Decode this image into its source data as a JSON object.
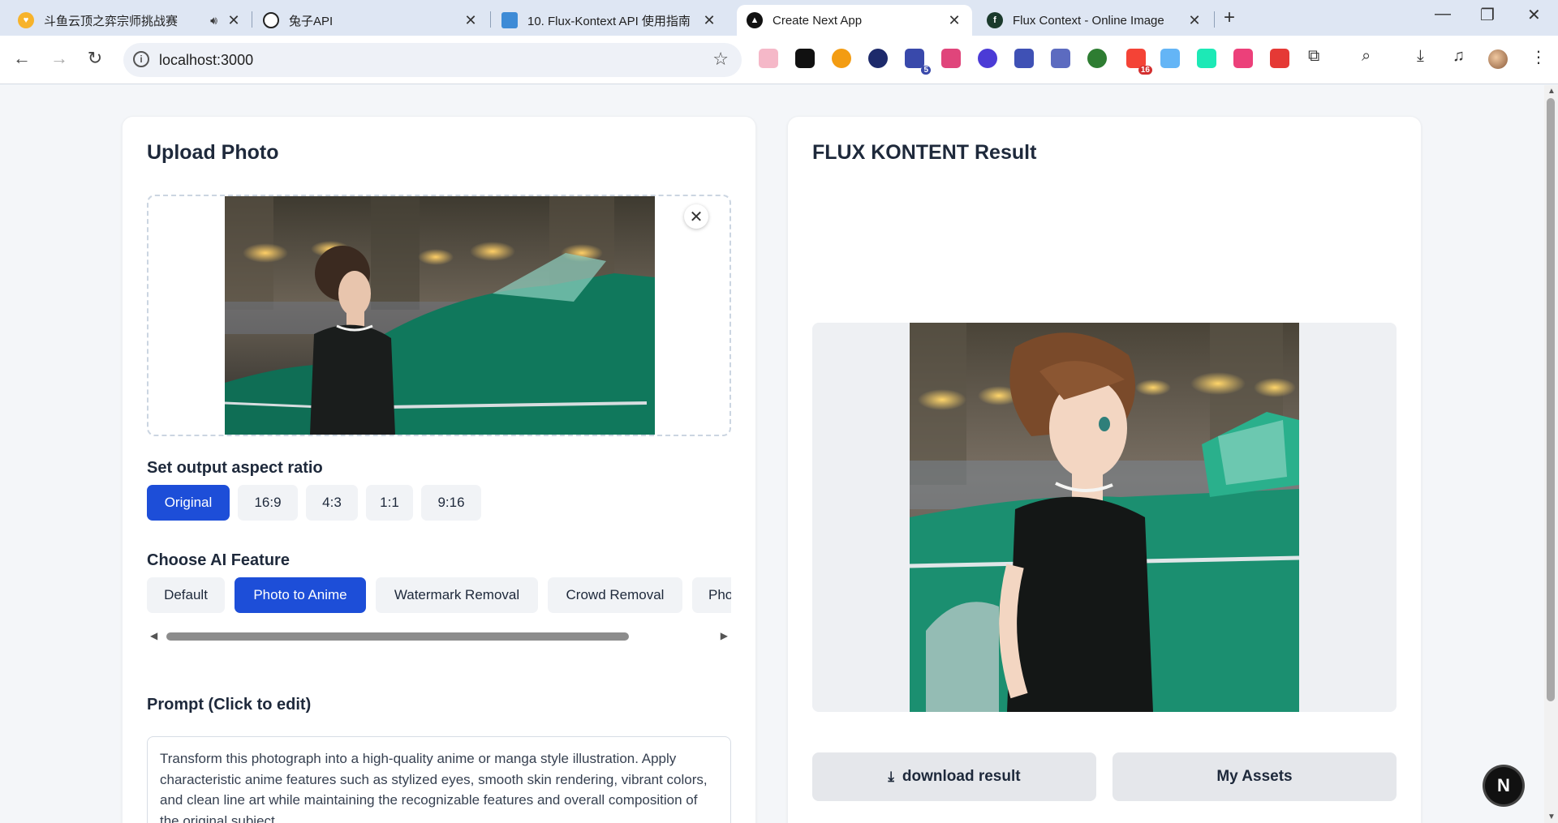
{
  "browser": {
    "tabs": [
      {
        "title": "斗鱼云顶之弈宗师挑战赛",
        "icon": "douyu-icon"
      },
      {
        "title": "兔子API",
        "icon": "openai-icon"
      },
      {
        "title": "10. Flux-Kontext API 使用指南",
        "icon": "gitbook-icon"
      },
      {
        "title": "Create Next App",
        "icon": "nextjs-icon"
      },
      {
        "title": "Flux Context - Online Image",
        "icon": "flux-icon"
      }
    ],
    "url": "localhost:3000",
    "extension_badges": [
      "5",
      "16"
    ],
    "fav_letters": {
      "flux": "f"
    }
  },
  "upload": {
    "title": "Upload Photo"
  },
  "aspect": {
    "title": "Set output aspect ratio",
    "options": [
      "Original",
      "16:9",
      "4:3",
      "1:1",
      "9:16"
    ],
    "selected": "Original"
  },
  "feature": {
    "title": "Choose AI Feature",
    "options": [
      "Default",
      "Photo to Anime",
      "Watermark Removal",
      "Crowd Removal",
      "Pho"
    ],
    "selected": "Photo to Anime"
  },
  "prompt": {
    "title": "Prompt (Click to edit)",
    "text": "Transform this photograph into a high-quality anime or manga style illustration. Apply characteristic anime features such as stylized eyes, smooth skin rendering, vibrant colors, and clean line art while maintaining the recognizable features and overall composition of the original subject."
  },
  "result": {
    "title": "FLUX KONTENT Result",
    "download_label": "download result",
    "assets_label": "My Assets"
  },
  "dev_badge": "N",
  "colors": {
    "accent": "#1d4ed8",
    "page_bg": "#f4f6f9"
  }
}
